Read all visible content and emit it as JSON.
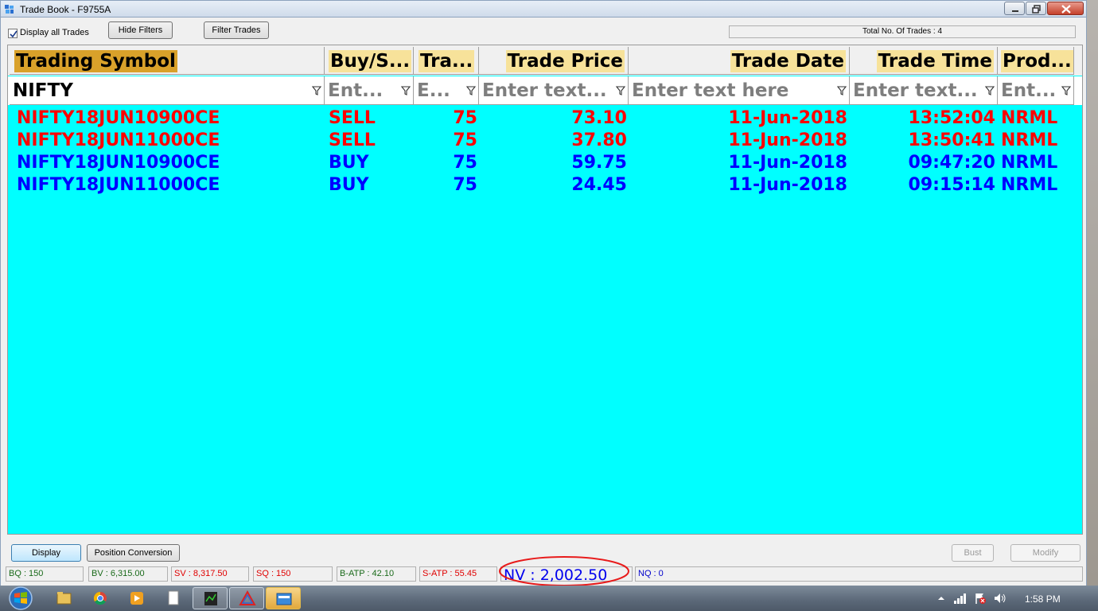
{
  "window": {
    "title": "Trade Book - F9755A"
  },
  "toolbar": {
    "display_all_trades_label": "Display all Trades",
    "display_all_trades_checked": true,
    "hide_filters_label": "Hide Filters",
    "filter_trades_label": "Filter Trades",
    "total_trades_label": "Total No. Of Trades : 4"
  },
  "grid": {
    "columns": [
      {
        "label": "Trading Symbol",
        "filter": "NIFTY",
        "filter_is_value": true
      },
      {
        "label": "Buy/S...",
        "filter": "Ent...",
        "filter_is_value": false
      },
      {
        "label": "Tra...",
        "filter": "E...",
        "filter_is_value": false
      },
      {
        "label": "Trade Price",
        "filter": "Enter text...",
        "filter_is_value": false
      },
      {
        "label": "Trade Date",
        "filter": "Enter text here",
        "filter_is_value": false
      },
      {
        "label": "Trade Time",
        "filter": "Enter text...",
        "filter_is_value": false
      },
      {
        "label": "Prod...",
        "filter": "Ent...",
        "filter_is_value": false
      }
    ],
    "rows": [
      {
        "symbol": "NIFTY18JUN10900CE",
        "side": "SELL",
        "qty": "75",
        "price": "73.10",
        "date": "11-Jun-2018",
        "time": "13:52:04",
        "product": "NRML",
        "color": "#ff0000"
      },
      {
        "symbol": "NIFTY18JUN11000CE",
        "side": "SELL",
        "qty": "75",
        "price": "37.80",
        "date": "11-Jun-2018",
        "time": "13:50:41",
        "product": "NRML",
        "color": "#ff0000"
      },
      {
        "symbol": "NIFTY18JUN10900CE",
        "side": "BUY",
        "qty": "75",
        "price": "59.75",
        "date": "11-Jun-2018",
        "time": "09:47:20",
        "product": "NRML",
        "color": "#0000ff"
      },
      {
        "symbol": "NIFTY18JUN11000CE",
        "side": "BUY",
        "qty": "75",
        "price": "24.45",
        "date": "11-Jun-2018",
        "time": "09:15:14",
        "product": "NRML",
        "color": "#0000ff"
      }
    ],
    "background_color": "#00ffff"
  },
  "actions": {
    "display_label": "Display",
    "position_conversion_label": "Position Conversion",
    "bust_label": "Bust",
    "modify_label": "Modify"
  },
  "status": {
    "bq": "BQ : 150",
    "bv": "BV : 6,315.00",
    "sv": "SV : 8,317.50",
    "sq": "SQ : 150",
    "batp": "B-ATP : 42.10",
    "satp": "S-ATP : 55.45",
    "nv": "NV : 2,002.50",
    "nq": "NQ : 0"
  },
  "taskbar": {
    "clock": "1:58 PM",
    "items": [
      "windows-explorer",
      "chrome",
      "media-player",
      "notepad",
      "trading-app",
      "prism-app",
      "trade-book-window"
    ]
  }
}
